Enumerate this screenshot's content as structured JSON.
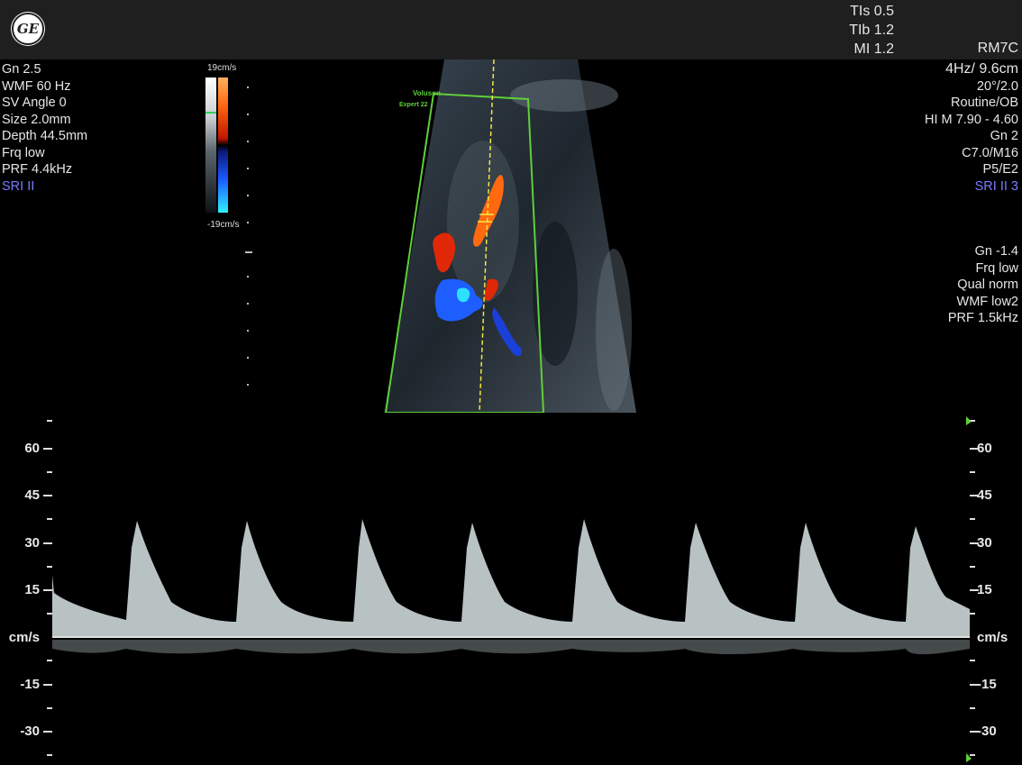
{
  "safety": {
    "tis": "TIs 0.5",
    "tib": "TIb 1.2",
    "mi": "MI 1.2"
  },
  "probe": "RM7C",
  "left_params": [
    "Gn  2.5",
    "WMF 60 Hz",
    "SV Angle  0",
    "Size  2.0mm",
    "Depth 44.5mm",
    "Frq low",
    "PRF  4.4kHz",
    "SRI II"
  ],
  "right_params": [
    "4Hz/ 9.6cm",
    "20°/2.0",
    "Routine/OB",
    "HI M  7.90 - 4.60",
    "Gn   2",
    "C7.0/M16",
    "P5/E2",
    "SRI II 3"
  ],
  "right_params2": [
    "Gn -1.4",
    "Frq low",
    "Qual norm",
    "WMF low2",
    "PRF  1.5kHz"
  ],
  "colorbar": {
    "top": "19cm/s",
    "bottom": "-19cm/s"
  },
  "image_label": {
    "line1": "Voluson",
    "line2": "Expert 22"
  },
  "doppler_scale": {
    "labels": [
      "60",
      "45",
      "30",
      "15",
      "cm/s",
      "-15",
      "-30"
    ],
    "values": [
      60,
      45,
      30,
      15,
      0,
      -15,
      -30
    ]
  },
  "colors": {
    "roi": "#5fcf3a",
    "sri": "#7b7bff"
  }
}
